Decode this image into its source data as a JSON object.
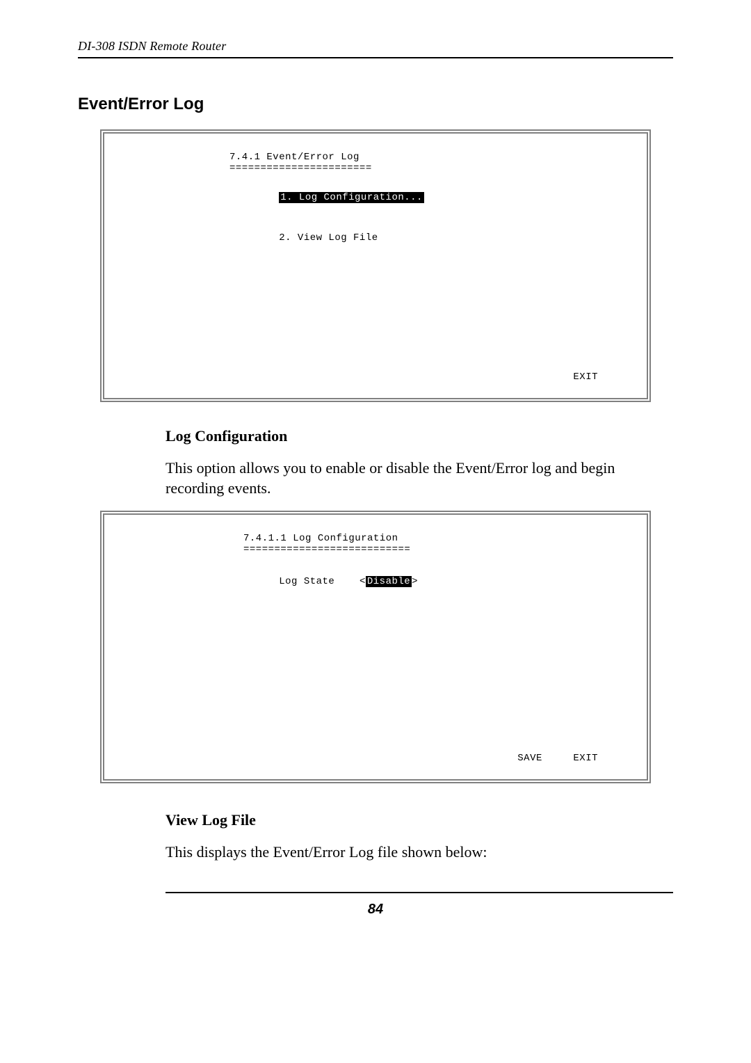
{
  "running_header": "DI-308 ISDN Remote Router",
  "section_title": "Event/Error Log",
  "term1": {
    "title": "7.4.1 Event/Error Log",
    "rule": "=======================",
    "item1_label": "1. Log Configuration...",
    "item2_label": "2. View Log File",
    "bottom": "EXIT"
  },
  "sub1_head": "Log Configuration",
  "sub1_para": "This option allows you to enable or disable the Event/Error log and begin recording events.",
  "term2": {
    "title": "7.4.1.1 Log Configuration",
    "rule": "===========================",
    "field_label": "Log State",
    "lt": "<",
    "value": "Disable",
    "gt": ">",
    "bottom": "SAVE     EXIT"
  },
  "sub2_head": "View Log File",
  "sub2_para": "This displays the Event/Error Log file shown below:",
  "page_number": "84"
}
